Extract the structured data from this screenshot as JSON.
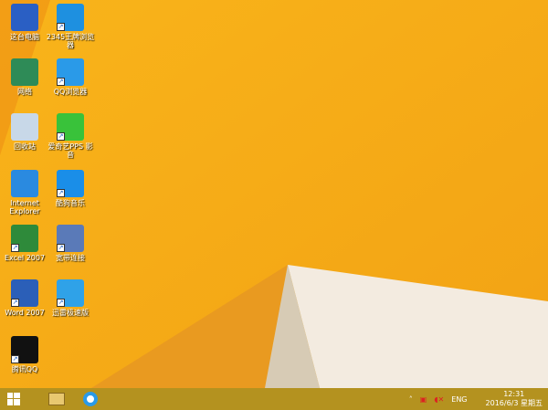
{
  "desktop": {
    "icons": [
      {
        "label": "这台电脑",
        "icon": "computer-icon",
        "color": "#2a5fc4"
      },
      {
        "label": "2345王牌浏览器",
        "icon": "browser-2345-icon",
        "color": "#1e90e0"
      },
      {
        "label": "网络",
        "icon": "network-icon",
        "color": "#2e8b57"
      },
      {
        "label": "QQ浏览器",
        "icon": "qq-browser-icon",
        "color": "#2a9ae8"
      },
      {
        "label": "回收站",
        "icon": "recycle-bin-icon",
        "color": "#c8d8e8"
      },
      {
        "label": "爱奇艺PPS 影音",
        "icon": "iqiyi-icon",
        "color": "#39c23a"
      },
      {
        "label": "Internet Explorer",
        "icon": "ie-icon",
        "color": "#2a8ae0"
      },
      {
        "label": "酷狗音乐",
        "icon": "kugou-icon",
        "color": "#1a8ee8"
      },
      {
        "label": "Excel 2007",
        "icon": "excel-icon",
        "color": "#2e8a3a"
      },
      {
        "label": "宽带连接",
        "icon": "broadband-icon",
        "color": "#5a7ab8"
      },
      {
        "label": "Word 2007",
        "icon": "word-icon",
        "color": "#2b5fb8"
      },
      {
        "label": "迅雷极速版",
        "icon": "xunlei-icon",
        "color": "#2fa2e8"
      },
      {
        "label": "腾讯QQ",
        "icon": "qq-icon",
        "color": "#111111"
      }
    ]
  },
  "taskbar": {
    "start": "start-icon",
    "pinned": [
      "file-explorer-icon",
      "qq-browser-icon"
    ]
  },
  "tray": {
    "language": "ENG",
    "time": "12:31",
    "date": "2016/6/3 星期五"
  }
}
